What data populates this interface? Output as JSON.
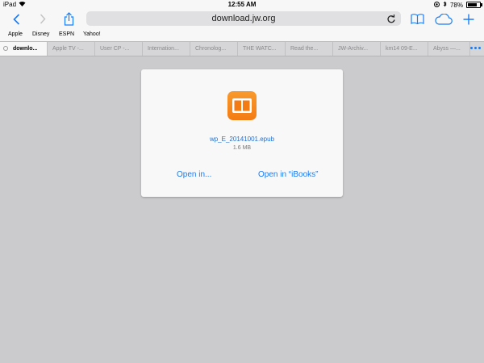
{
  "status_bar": {
    "device": "iPad",
    "time": "12:55 AM",
    "battery": "78%",
    "battery_level": 0.78
  },
  "toolbar": {
    "address": "download.jw.org"
  },
  "bookmarks": [
    "Apple",
    "Disney",
    "ESPN",
    "Yahoo!"
  ],
  "tabs": [
    {
      "label": "downlo...",
      "active": true
    },
    {
      "label": "Apple TV -...",
      "active": false
    },
    {
      "label": "User CP -...",
      "active": false
    },
    {
      "label": "Internation...",
      "active": false
    },
    {
      "label": "Chronolog...",
      "active": false
    },
    {
      "label": "THE WATC...",
      "active": false
    },
    {
      "label": "Read the...",
      "active": false
    },
    {
      "label": "JW-Archiv...",
      "active": false
    },
    {
      "label": "km14 09-E...",
      "active": false
    },
    {
      "label": "Abyss —...",
      "active": false
    }
  ],
  "download": {
    "filename": "wp_E_20141001.epub",
    "size": "1.6 MB",
    "open_in": "Open in...",
    "open_ibooks": "Open in “iBooks”",
    "icon": "ibooks-icon"
  },
  "colors": {
    "accent": "#1a7cf5",
    "ibooks_orange": "#f47b14",
    "background": "#cbcbcd"
  }
}
